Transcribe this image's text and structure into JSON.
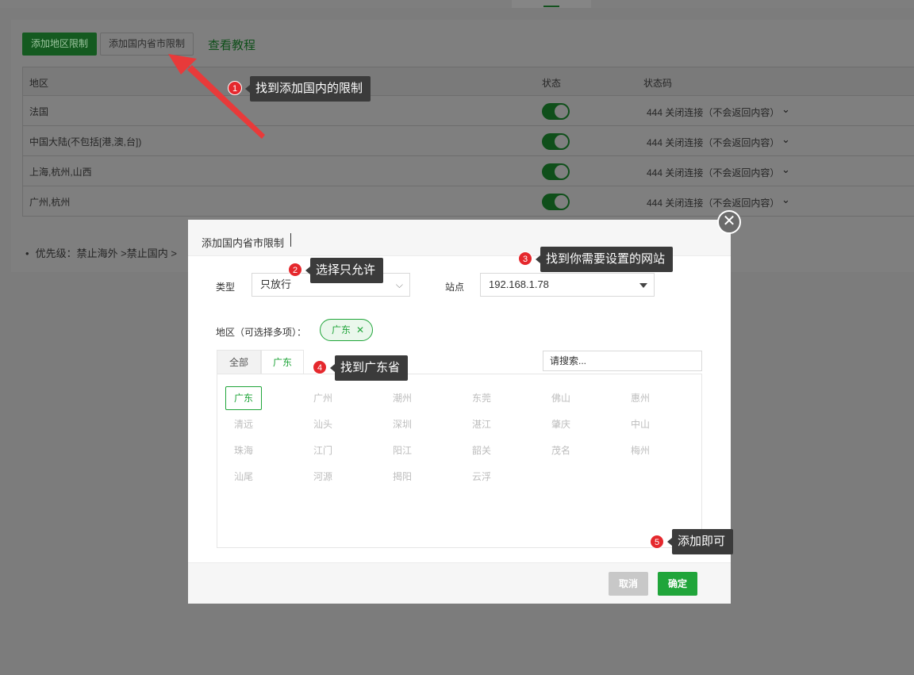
{
  "background": {
    "add_region_btn": "添加地区限制",
    "add_domestic_btn": "添加国内省市限制",
    "tutorial_link": "查看教程",
    "table": {
      "headers": [
        "地区",
        "状态",
        "状态码"
      ],
      "rows": [
        {
          "region": "法国",
          "status": "on",
          "code": "444 关闭连接（不会返回内容）"
        },
        {
          "region": "中国大陆(不包括[港,澳,台])",
          "status": "on",
          "code": "444 关闭连接（不会返回内容）"
        },
        {
          "region": "上海,杭州,山西",
          "status": "on",
          "code": "444 关闭连接（不会返回内容）"
        },
        {
          "region": "广州,杭州",
          "status": "on",
          "code": "444 关闭连接（不会返回内容）"
        }
      ]
    },
    "priority_note": "优先级：禁止海外 >禁止国内 >"
  },
  "dialog": {
    "title": "添加国内省市限制",
    "close_glyph": "✕",
    "type_label": "类型",
    "type_value": "只放行",
    "site_label": "站点",
    "site_value": "192.168.1.78",
    "region_label": "地区（可选择多项）：",
    "selected_tag": "广东",
    "tag_remove": "✕",
    "tabs": [
      "全部",
      "广东"
    ],
    "search_placeholder": "请搜索...",
    "cities": [
      "广东",
      "广州",
      "潮州",
      "东莞",
      "佛山",
      "惠州",
      "清远",
      "汕头",
      "深圳",
      "湛江",
      "肇庆",
      "中山",
      "珠海",
      "江门",
      "阳江",
      "韶关",
      "茂名",
      "梅州",
      "汕尾",
      "河源",
      "揭阳",
      "云浮"
    ],
    "cancel_btn": "取消",
    "confirm_btn": "确定"
  },
  "annotations": [
    {
      "num": "1",
      "text": "找到添加国内的限制"
    },
    {
      "num": "2",
      "text": "选择只允许"
    },
    {
      "num": "3",
      "text": "找到你需要设置的网站"
    },
    {
      "num": "4",
      "text": "找到广东省"
    },
    {
      "num": "5",
      "text": "添加即可"
    }
  ],
  "colors": {
    "accent": "#20a53a",
    "annotation_bg": "#3b3b3b",
    "badge": "#e5282d",
    "arrow": "#e83a3a"
  }
}
